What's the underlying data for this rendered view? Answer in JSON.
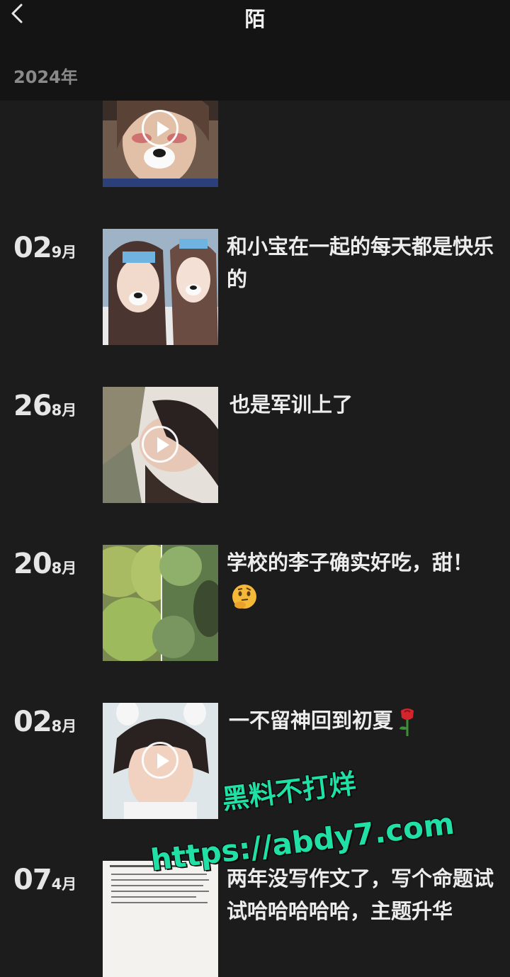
{
  "header": {
    "title": "陌",
    "year": "2024年"
  },
  "posts": [
    {
      "day": "",
      "month": "",
      "caption": "",
      "is_video": true
    },
    {
      "day": "02",
      "month": "9月",
      "caption": "和小宝在一起的每天都是快乐的",
      "is_video": false
    },
    {
      "day": "26",
      "month": "8月",
      "caption": "也是军训上了",
      "is_video": true
    },
    {
      "day": "20",
      "month": "8月",
      "caption": "学校的李子确实好吃，甜！",
      "is_video": false
    },
    {
      "day": "02",
      "month": "8月",
      "caption": "一不留神回到初夏",
      "is_video": true
    },
    {
      "day": "07",
      "month": "4月",
      "caption": "两年没写作文了，写个命题试试哈哈哈哈哈，主题升华",
      "is_video": false
    }
  ],
  "watermark": {
    "line1": "黑料不打烊",
    "line2": "https://abdy7.com"
  },
  "icons": {
    "back": "chevron-left-icon",
    "play": "play-icon",
    "thinking": "thinking-face-icon",
    "rose": "rose-icon"
  }
}
